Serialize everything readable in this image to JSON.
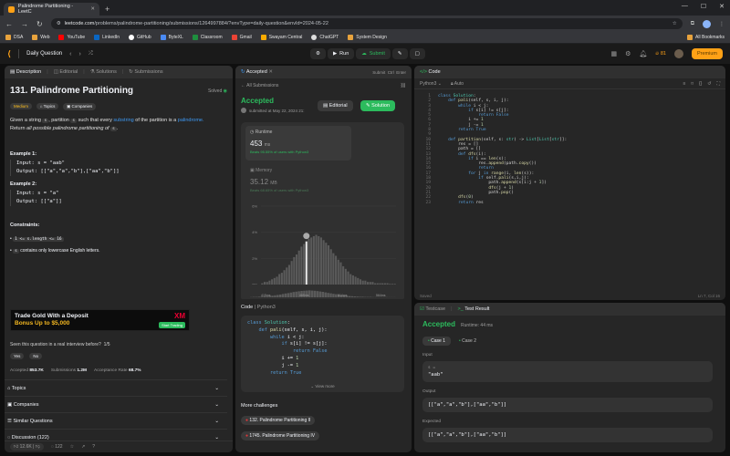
{
  "browser": {
    "tab_title": "Palindrome Partitioning - LeetC",
    "url_host": "leetcode.com",
    "url_path": "/problems/palindrome-partitioning/submissions/1264997884/?envType=daily-question&envId=2024-05-22",
    "bookmarks": [
      "DSA",
      "Web",
      "YouTube",
      "LinkedIn",
      "GitHub",
      "ByteXL",
      "Classroom",
      "Gmail",
      "Swayam Central",
      "ChatGPT",
      "System Design"
    ],
    "all_bookmarks": "All Bookmarks"
  },
  "nav": {
    "daily": "Daily Question",
    "run": "Run",
    "submit": "Submit",
    "streak": "81",
    "premium": "Premium"
  },
  "left": {
    "tabs": [
      "Description",
      "Editorial",
      "Solutions",
      "Submissions"
    ],
    "title": "131. Palindrome Partitioning",
    "solved": "Solved",
    "tags": [
      "Medium",
      "Topics",
      "Companies"
    ],
    "desc_a": "Given a string",
    "desc_s": "s",
    "desc_b": ", partition",
    "desc_c": "such that every",
    "desc_sub": "substring",
    "desc_d": "of the partition is a",
    "desc_pal": "palindrome.",
    "desc_e": "Return",
    "desc_all": "all possible palindrome partitioning of",
    "ex1_title": "Example 1:",
    "ex1_input": "Input: s = \"aab\"",
    "ex1_output": "Output: [[\"a\",\"a\",\"b\"],[\"aa\",\"b\"]]",
    "ex2_title": "Example 2:",
    "ex2_input": "Input: s = \"a\"",
    "ex2_output": "Output: [[\"a\"]]",
    "constraints_title": "Constraints:",
    "c1": "1 <= s.length <= 16",
    "c2_code": "s",
    "c2": "contains only lowercase English letters.",
    "ad_line1": "Trade Gold With a Deposit",
    "ad_line2": "Bonus Up to $5,000",
    "ad_brand": "XM",
    "ad_cta": "Start Trading",
    "seen_q": "Seen this question in a real interview before?",
    "seen_count": "1/5",
    "yes": "Yes",
    "no": "No",
    "accepted_label": "Accepted",
    "accepted_val": "853.7K",
    "submissions_label": "Submissions",
    "submissions_val": "1.2M",
    "rate_label": "Acceptance Rate",
    "rate_val": "68.7%",
    "accordions": [
      "Topics",
      "Companies",
      "Similar Questions",
      "Discussion (122)"
    ],
    "likes": "12.6K",
    "comments": "122"
  },
  "mid": {
    "tab": "Accepted",
    "submit_key": "Submit",
    "ctrl_key": "Ctrl",
    "enter_key": "Enter",
    "back": "All Submissions",
    "status": "Accepted",
    "submitted": "submitted at May 22, 2024 21:",
    "editorial": "Editorial",
    "solution": "Solution",
    "runtime_label": "Runtime",
    "runtime_val": "453",
    "runtime_unit": "ms",
    "runtime_beats": "Beats 95.55% of users with Python3",
    "memory_label": "Memory",
    "memory_val": "35.12",
    "memory_unit": "MB",
    "memory_beats": "Beats 68.65% of users with Python3",
    "code_label": "Code",
    "code_lang": "Python3",
    "view_more": "View more",
    "more_title": "More challenges",
    "challenges": [
      "132. Palindrome Partitioning II",
      "1745. Palindrome Partitioning IV"
    ]
  },
  "chart_data": {
    "type": "bar",
    "yticks": [
      "6%",
      "4%",
      "2%",
      "0%"
    ],
    "xticks": [
      "415ms",
      "465ms",
      "514ms",
      "564ms"
    ],
    "highlight_x": "465ms",
    "values": [
      0.1,
      0.2,
      0.2,
      0.3,
      0.4,
      0.5,
      0.6,
      0.8,
      0.9,
      1.1,
      1.3,
      1.5,
      1.8,
      2.1,
      2.3,
      2.6,
      2.9,
      3.1,
      3.3,
      3.5,
      3.6,
      3.7,
      3.8,
      3.7,
      3.6,
      3.4,
      3.2,
      3.0,
      2.7,
      2.4,
      2.2,
      1.9,
      1.7,
      1.4,
      1.2,
      1.0,
      0.8,
      0.7,
      0.6,
      0.5,
      0.4,
      0.3,
      0.3,
      0.2,
      0.2,
      0.2,
      0.1,
      0.1,
      0.1,
      0.1,
      0.1,
      0.1,
      0.05,
      0.05,
      0.05
    ],
    "highlight_index": 18,
    "ylim": [
      0,
      6
    ],
    "mini_xticks": [
      "415ms",
      "465ms",
      "514ms",
      "564ms"
    ]
  },
  "right": {
    "tab": "Code",
    "lang": "Python3",
    "auto": "Auto",
    "saved": "Saved",
    "cursor": "Ln 7, Col 16",
    "code": [
      "class Solution:",
      "    def pali(self, s, i, j):",
      "        while i < j:",
      "            if s[i] != s[j]:",
      "                return False",
      "            i += 1",
      "            j -= 1",
      "        return True",
      "",
      "    def partition(self, s: str) -> List[List[str]]:",
      "        res = []",
      "        path = []",
      "        def dfs(i):",
      "            if i == len(s):",
      "                res.append(path.copy())",
      "                return",
      "            for j in range(i, len(s)):",
      "                if self.pali(s,i,j):",
      "                    path.append(s[i:j + 1])",
      "                    dfs(j + 1)",
      "                    path.pop()",
      "        dfs(0)",
      "        return res"
    ],
    "testcase_tab": "Testcase",
    "result_tab": "Test Result",
    "result_status": "Accepted",
    "result_runtime": "Runtime: 44 ms",
    "case1": "Case 1",
    "case2": "Case 2",
    "input_label": "Input",
    "input_var": "s =",
    "input_val": "\"aab\"",
    "output_label": "Output",
    "output_val": "[[\"a\",\"a\",\"b\"],[\"aa\",\"b\"]]",
    "expected_label": "Expected",
    "expected_val": "[[\"a\",\"a\",\"b\"],[\"aa\",\"b\"]]"
  },
  "mid_code": [
    "class Solution:",
    "    def pali(self, s, i, j):",
    "        while i < j:",
    "            if s[i] != s[j]:",
    "                return False",
    "            i += 1",
    "            j -= 1",
    "        return True"
  ]
}
